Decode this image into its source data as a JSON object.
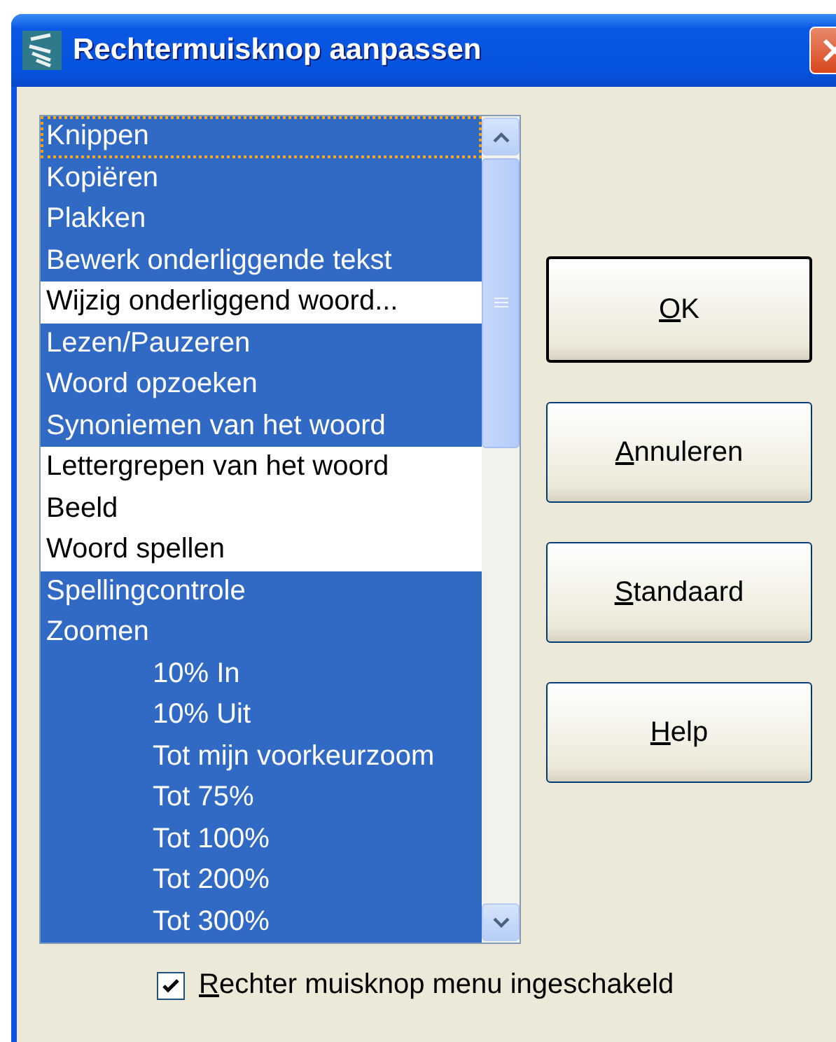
{
  "window": {
    "title": "Rechtermuisknop aanpassen"
  },
  "menu_items": [
    {
      "label": "Knippen",
      "selected": true,
      "focused": true
    },
    {
      "label": "Kopiëren",
      "selected": true,
      "focused": false
    },
    {
      "label": "Plakken",
      "selected": true,
      "focused": false
    },
    {
      "label": "Bewerk onderliggende tekst",
      "selected": true,
      "focused": false
    },
    {
      "label": "Wijzig onderliggend woord...",
      "selected": false,
      "focused": false
    },
    {
      "label": "Lezen/Pauzeren",
      "selected": true,
      "focused": false
    },
    {
      "label": "Woord opzoeken",
      "selected": true,
      "focused": false
    },
    {
      "label": "Synoniemen van het woord",
      "selected": true,
      "focused": false
    },
    {
      "label": "Lettergrepen van het woord",
      "selected": false,
      "focused": false
    },
    {
      "label": "Beeld",
      "selected": false,
      "focused": false
    },
    {
      "label": "Woord spellen",
      "selected": false,
      "focused": false
    },
    {
      "label": "Spellingcontrole",
      "selected": true,
      "focused": false
    },
    {
      "label": "Zoomen",
      "selected": true,
      "focused": false,
      "children": [
        {
          "label": "10% In",
          "selected": true,
          "focused": false
        },
        {
          "label": "10% Uit",
          "selected": true,
          "focused": false
        },
        {
          "label": "Tot mijn voorkeurzoom",
          "selected": true,
          "focused": false
        },
        {
          "label": "Tot 75%",
          "selected": true,
          "focused": false
        },
        {
          "label": "Tot 100%",
          "selected": true,
          "focused": false
        },
        {
          "label": "Tot 200%",
          "selected": true,
          "focused": false
        },
        {
          "label": "Tot 300%",
          "selected": true,
          "focused": false
        }
      ]
    }
  ],
  "buttons": [
    {
      "accel": "O",
      "rest": "K",
      "default": true
    },
    {
      "accel": "A",
      "rest": "nnuleren",
      "default": false
    },
    {
      "accel": "S",
      "rest": "tandaard",
      "default": false
    },
    {
      "accel": "H",
      "rest": "elp",
      "default": false
    }
  ],
  "enable_checkbox": {
    "accel": "R",
    "rest": "echter muisknop menu ingeschakeld",
    "checked": true
  }
}
